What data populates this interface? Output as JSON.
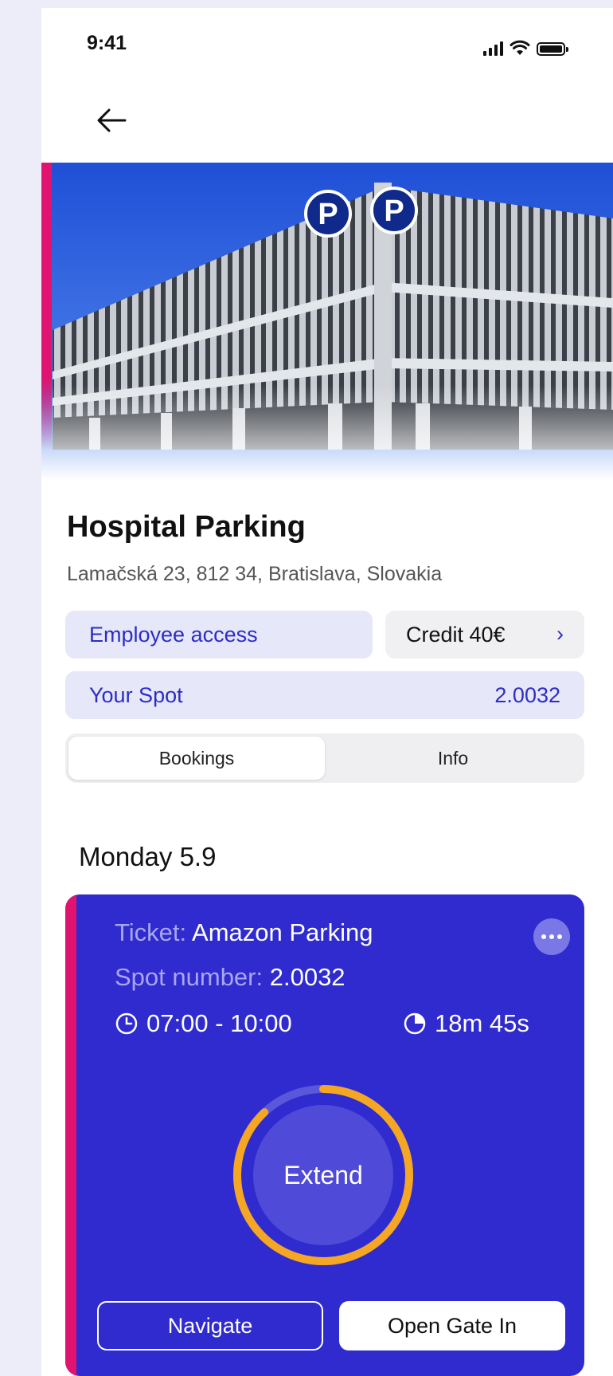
{
  "status_bar": {
    "time": "9:41"
  },
  "parking": {
    "name": "Hospital Parking",
    "address": "Lamačská 23, 812 34, Bratislava, Slovakia",
    "access_label": "Employee access",
    "credit_label": "Credit 40€",
    "credit_chevron": "›",
    "spot_label": "Your Spot",
    "spot_value": "2.0032"
  },
  "tabs": [
    {
      "label": "Bookings",
      "active": true
    },
    {
      "label": "Info",
      "active": false
    }
  ],
  "day_heading": "Monday 5.9",
  "booking": {
    "ticket_label": "Ticket:",
    "ticket_value": "Amazon Parking",
    "spot_label": "Spot number:",
    "spot_value": "2.0032",
    "time_range": "07:00 - 10:00",
    "remaining": "18m 45s",
    "extend_label": "Extend",
    "progress_fraction": 0.88,
    "navigate_label": "Navigate",
    "open_gate_label": "Open Gate In"
  },
  "icons": {
    "back": "arrow-left-icon",
    "clock": "clock-icon",
    "timer": "pie-timer-icon",
    "more": "more-dots-icon",
    "signal": "signal-icon",
    "wifi": "wifi-icon",
    "battery": "battery-icon"
  },
  "colors": {
    "accent": "#2f2bcf",
    "brand_pink": "#e01470",
    "progress": "#f5a623",
    "pill_bg": "#e6e7f9"
  }
}
